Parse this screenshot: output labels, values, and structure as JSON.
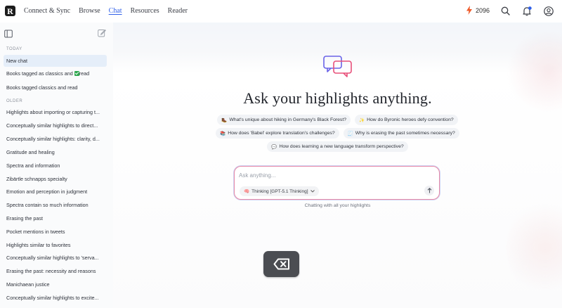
{
  "app": {
    "logo_letter": "R",
    "nav": [
      {
        "label": "Connect & Sync",
        "active": false
      },
      {
        "label": "Browse",
        "active": false
      },
      {
        "label": "Chat",
        "active": true
      },
      {
        "label": "Resources",
        "active": false
      },
      {
        "label": "Reader",
        "active": false
      }
    ],
    "streak_count": "2096",
    "notification_dot_color": "#2f5fe8",
    "accent_color": "#2f5fe8"
  },
  "sidebar": {
    "sections": [
      {
        "label": "TODAY",
        "items": [
          {
            "label": "New chat",
            "active": true
          },
          {
            "label_before": "Books tagged as classics and ",
            "label_after": "read",
            "icon": "checkmark-icon"
          },
          {
            "label": "Books tagged classics and read"
          }
        ]
      },
      {
        "label": "OLDER",
        "items": [
          {
            "label": "Highlights about importing or capturing t..."
          },
          {
            "label": "Conceptually similar highlights to direct..."
          },
          {
            "label": "Conceptually similar highlights: clarity, d..."
          },
          {
            "label": "Gratitude and healing"
          },
          {
            "label": "Spectra and information"
          },
          {
            "label": "Zibärtle schnapps specialty"
          },
          {
            "label": "Emotion and perception in judgment"
          },
          {
            "label": "Spectra contain so much information"
          },
          {
            "label": "Erasing the past"
          },
          {
            "label": "Pocket mentions in tweets"
          },
          {
            "label": "Highlights similar to favorites"
          },
          {
            "label": "Conceptually similar highlights to 'serva..."
          },
          {
            "label": "Erasing the past: necessity and reasons"
          },
          {
            "label": "Manichaean justice"
          },
          {
            "label": "Conceptually similar highlights to excite..."
          }
        ]
      }
    ]
  },
  "main": {
    "title": "Ask your highlights anything.",
    "suggestions": [
      [
        {
          "emoji": "🥾",
          "label": "What's unique about hiking in Germany's Black Forest?"
        },
        {
          "emoji": "✨",
          "label": "How do Byronic heroes defy convention?"
        }
      ],
      [
        {
          "emoji": "📚",
          "label": "How does 'Babel' explore translation's challenges?"
        },
        {
          "emoji": "🧾",
          "label": "Why is erasing the past sometimes necessary?"
        }
      ],
      [
        {
          "emoji": "💬",
          "label": "How does learning a new language transform perspective?"
        }
      ]
    ],
    "input_placeholder": "Ask anything...",
    "model_label": "Thinking [GPT-5.1 Thinking]",
    "model_emoji": "🧠",
    "caption": "Chatting with all your highlights"
  },
  "overlay": {
    "icon": "backspace-icon"
  }
}
